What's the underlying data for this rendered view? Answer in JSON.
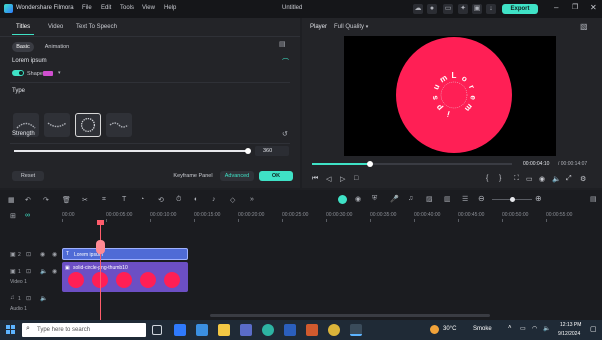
{
  "app": {
    "name": "Wondershare Filmora",
    "menu": [
      "File",
      "Edit",
      "Tools",
      "View",
      "Help"
    ],
    "doc_title": "Untitled",
    "export_label": "Export"
  },
  "left_panel": {
    "tabs": [
      "Titles",
      "Video",
      "Text To Speech"
    ],
    "subtabs": [
      "Basic",
      "Animation"
    ],
    "section_title": "Lorem ipsum",
    "shape_label": "Shape",
    "type_label": "Type",
    "strength_label": "Strength",
    "strength_value": "360",
    "strength_fraction": 1.0,
    "reset_label": "Reset",
    "keyframe_label": "Keyframe Panel",
    "advanced_label": "Advanced",
    "ok_label": "OK"
  },
  "player": {
    "label": "Player",
    "quality": "Full Quality",
    "current_time": "00:00:04:10",
    "total_time": "/ 00:00:14:07",
    "progress_fraction": 0.29,
    "canvas_text": "Lorem ipsum",
    "circle_color": "#ff1f55"
  },
  "timeline": {
    "ruler": [
      "00:00",
      "00:00:05:00",
      "00:00:10:00",
      "00:00:15:00",
      "00:00:20:00",
      "00:00:25:00",
      "00:00:30:00",
      "00:00:35:00",
      "00:00:40:00",
      "00:00:45:00",
      "00:00:50:00",
      "00:00:55:00"
    ],
    "title_clip": "Lorem ipsum",
    "video_clip": "solid-circle-png-thumb10",
    "video_track_label": "Video 1",
    "audio_track_label": "Audio 1",
    "track_numbers": [
      "2",
      "1",
      "1"
    ]
  },
  "taskbar": {
    "search_placeholder": "Type here to search",
    "temperature": "30°C",
    "weather": "Smoke",
    "time": "12:13 PM",
    "date": "9/12/2024"
  },
  "colors": {
    "accent": "#3fe2c6",
    "clip_title": "#4f6bd6",
    "clip_video": "#6c4fc4",
    "playhead": "#ff5d6c"
  }
}
